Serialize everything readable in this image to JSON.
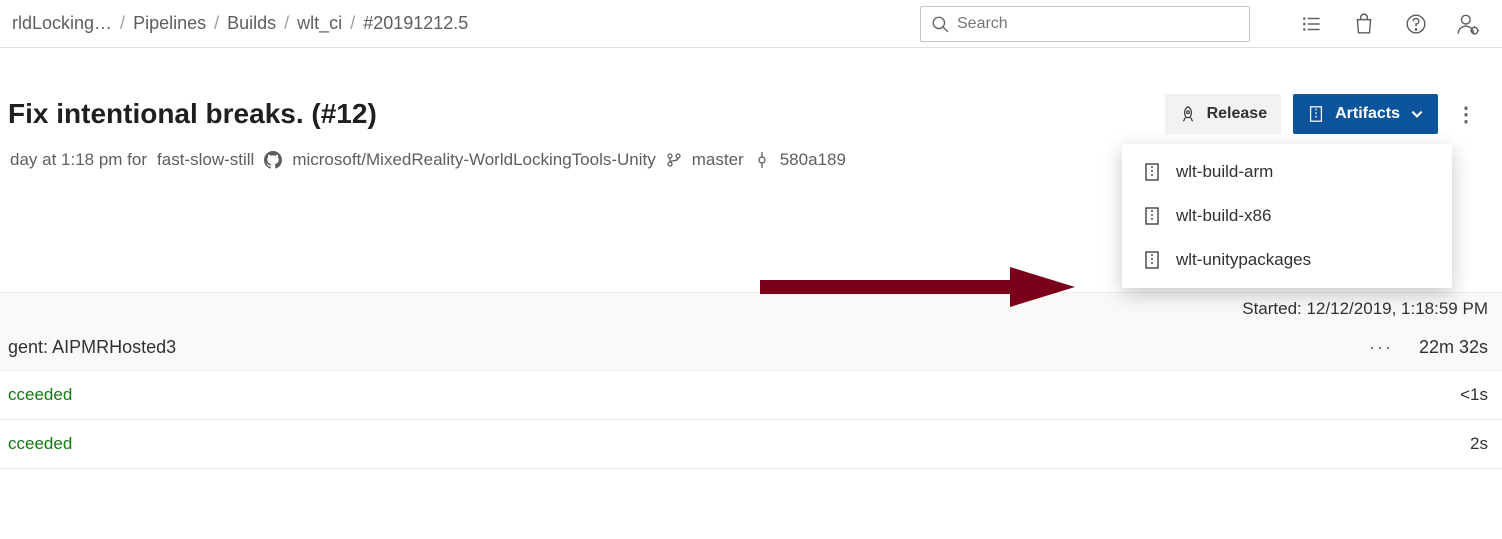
{
  "breadcrumb": {
    "items": [
      "rldLocking…",
      "Pipelines",
      "Builds",
      "wlt_ci",
      "#20191212.5"
    ]
  },
  "search": {
    "placeholder": "Search"
  },
  "page": {
    "title": "Fix intentional breaks. (#12)"
  },
  "actions": {
    "release": "Release",
    "artifacts": "Artifacts"
  },
  "meta": {
    "time_prefix": "day at 1:18 pm for",
    "user": "fast-slow-still",
    "repo": "microsoft/MixedReality-WorldLockingTools-Unity",
    "branch": "master",
    "commit": "580a189"
  },
  "artifacts_menu": [
    "wlt-build-arm",
    "wlt-build-x86",
    "wlt-unitypackages"
  ],
  "job": {
    "started_label": "Started:",
    "started_value": "12/12/2019, 1:18:59 PM",
    "agent_label": "gent:",
    "agent_name": "AIPMRHosted3",
    "duration": "22m 32s"
  },
  "tasks": [
    {
      "status": "cceeded",
      "duration": "<1s"
    },
    {
      "status": "cceeded",
      "duration": "2s"
    }
  ],
  "colors": {
    "primary": "#0b549b",
    "success": "#107c10",
    "arrow": "#7a0019"
  }
}
